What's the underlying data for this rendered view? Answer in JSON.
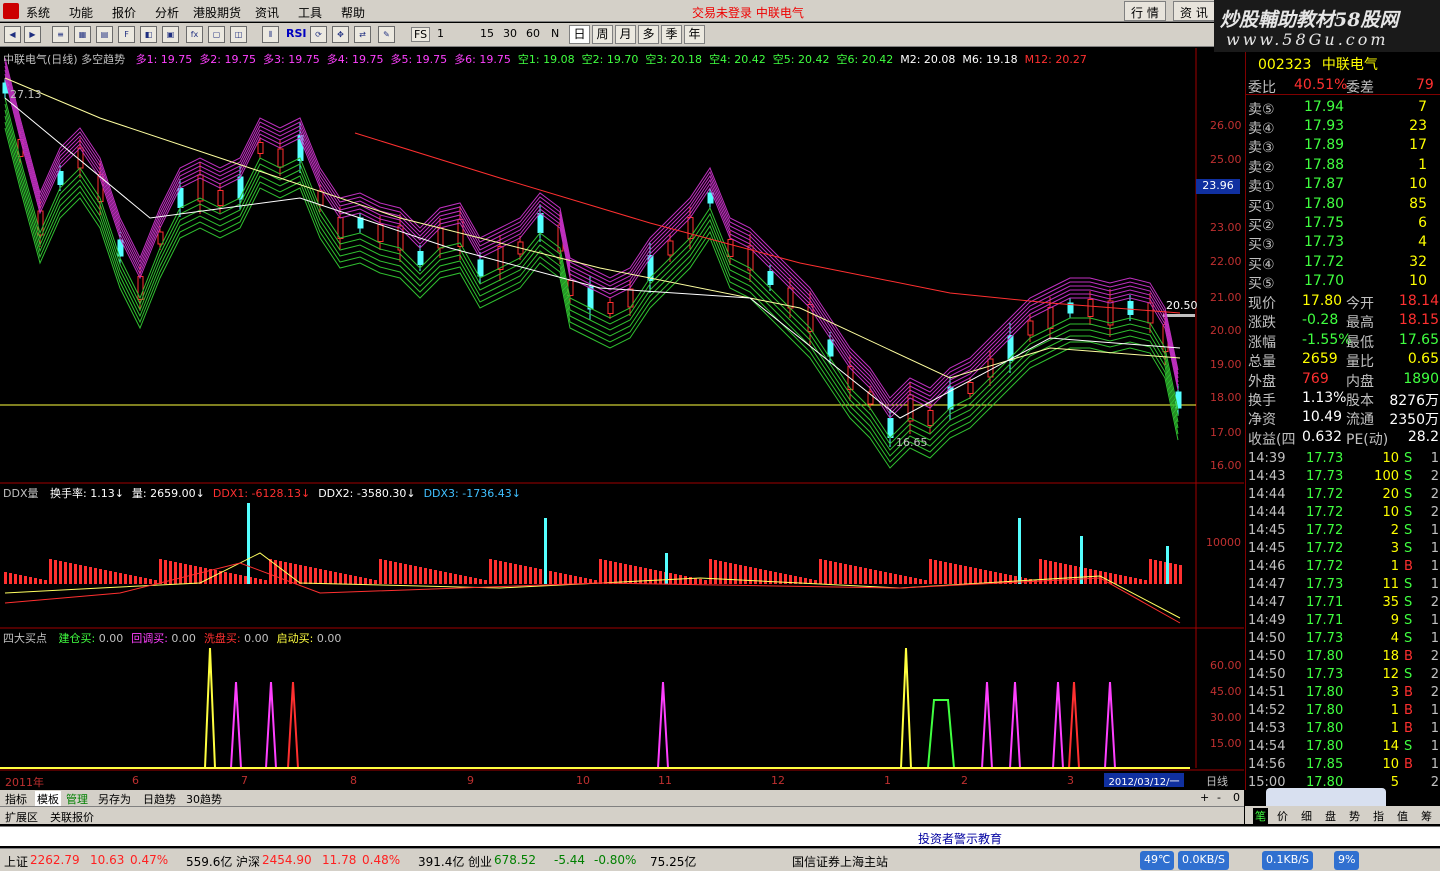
{
  "menu": {
    "items": [
      "系统",
      "功能",
      "报价",
      "分析",
      "港股期货",
      "资讯",
      "工具",
      "帮助"
    ],
    "warning": "交易未登录  中联电气",
    "right_buttons": [
      "行 情",
      "资 讯"
    ]
  },
  "banner": {
    "line1": "炒股輔助教材58股网",
    "line2": "www.58Gu.com"
  },
  "toolbar": {
    "text_buttons": [
      "RSI",
      "FS"
    ],
    "periods": [
      "1",
      "15",
      "30",
      "60",
      "N"
    ],
    "period_buttons": [
      "日",
      "周",
      "月",
      "多",
      "季",
      "年"
    ]
  },
  "main_chart": {
    "title": "中联电气(日线) 多空趋势",
    "legend": [
      {
        "name": "多1:",
        "value": "19.75",
        "color": "#ff40ff"
      },
      {
        "name": "多2:",
        "value": "19.75",
        "color": "#ff40ff"
      },
      {
        "name": "多3:",
        "value": "19.75",
        "color": "#ff40ff"
      },
      {
        "name": "多4:",
        "value": "19.75",
        "color": "#ff40ff"
      },
      {
        "name": "多5:",
        "value": "19.75",
        "color": "#ff40ff"
      },
      {
        "name": "多6:",
        "value": "19.75",
        "color": "#ff40ff"
      },
      {
        "name": "空1:",
        "value": "19.08",
        "color": "#40ff40"
      },
      {
        "name": "空2:",
        "value": "19.70",
        "color": "#40ff40"
      },
      {
        "name": "空3:",
        "value": "20.18",
        "color": "#40ff40"
      },
      {
        "name": "空4:",
        "value": "20.42",
        "color": "#40ff40"
      },
      {
        "name": "空5:",
        "value": "20.42",
        "color": "#40ff40"
      },
      {
        "name": "空6:",
        "value": "20.42",
        "color": "#40ff40"
      },
      {
        "name": "M2:",
        "value": "20.08",
        "color": "#ffffff"
      },
      {
        "name": "M6:",
        "value": "19.18",
        "color": "#ffffff"
      },
      {
        "name": "M12:",
        "value": "20.27",
        "color": "#ff3030"
      }
    ],
    "price_axis": [
      "26.00",
      "25.00",
      "24.00",
      "23.00",
      "22.00",
      "21.00",
      "20.00",
      "19.00",
      "18.00",
      "17.00",
      "16.00"
    ],
    "cursor_price": "23.96",
    "hi_label": "27.13",
    "lo_label": "16.65",
    "current_label": "20.50"
  },
  "volume_panel": {
    "title": "DDX量",
    "items": [
      {
        "label": "换手率:",
        "value": "1.13",
        "color": "#ffffff"
      },
      {
        "label": "量:",
        "value": "2659.00",
        "color": "#ffffff"
      },
      {
        "label": "DDX1:",
        "value": "-6128.13",
        "color": "#ff3030"
      },
      {
        "label": "DDX2:",
        "value": "-3580.30",
        "color": "#ffffff"
      },
      {
        "label": "DDX3:",
        "value": "-1736.43",
        "color": "#40c0ff"
      }
    ],
    "axis": [
      "10000"
    ]
  },
  "signal_panel": {
    "title": "四大买点",
    "items": [
      {
        "label": "建仓买:",
        "value": "0.00",
        "color": "#40ff40"
      },
      {
        "label": "回调买:",
        "value": "0.00",
        "color": "#ff40ff"
      },
      {
        "label": "洗盘买:",
        "value": "0.00",
        "color": "#ff3030"
      },
      {
        "label": "启动买:",
        "value": "0.00",
        "color": "#ffff40"
      }
    ],
    "axis": [
      "60.00",
      "45.00",
      "30.00",
      "15.00"
    ]
  },
  "time_axis": {
    "labels": [
      "2011年",
      "6",
      "7",
      "8",
      "9",
      "10",
      "11",
      "12",
      "1",
      "2",
      "3"
    ],
    "cursor_date": "2012/03/12/一",
    "period": "日线"
  },
  "bottom_tabs": [
    "指标",
    "模板",
    "管理",
    "另存为",
    "日趋势",
    "30趋势"
  ],
  "bottom_tabs2": [
    "扩展区",
    "关联报价"
  ],
  "quote": {
    "code": "002323",
    "name": "中联电气",
    "wei": {
      "label1": "委比",
      "value1": "40.51%",
      "label2": "委差",
      "value2": "79"
    },
    "asks": [
      {
        "label": "卖⑤",
        "price": "17.94",
        "vol": "7"
      },
      {
        "label": "卖④",
        "price": "17.93",
        "vol": "23"
      },
      {
        "label": "卖③",
        "price": "17.89",
        "vol": "17"
      },
      {
        "label": "卖②",
        "price": "17.88",
        "vol": "1"
      },
      {
        "label": "卖①",
        "price": "17.87",
        "vol": "10"
      }
    ],
    "bids": [
      {
        "label": "买①",
        "price": "17.80",
        "vol": "85"
      },
      {
        "label": "买②",
        "price": "17.75",
        "vol": "6"
      },
      {
        "label": "买③",
        "price": "17.73",
        "vol": "4"
      },
      {
        "label": "买④",
        "price": "17.72",
        "vol": "32"
      },
      {
        "label": "买⑤",
        "price": "17.70",
        "vol": "10"
      }
    ],
    "stats": [
      {
        "l1": "现价",
        "v1": "17.80",
        "c1": "#ffff00",
        "l2": "今开",
        "v2": "18.14",
        "c2": "#ff3030"
      },
      {
        "l1": "涨跌",
        "v1": "-0.28",
        "c1": "#40ff40",
        "l2": "最高",
        "v2": "18.15",
        "c2": "#ff3030"
      },
      {
        "l1": "涨幅",
        "v1": "-1.55%",
        "c1": "#40ff40",
        "l2": "最低",
        "v2": "17.65",
        "c2": "#40ff40"
      },
      {
        "l1": "总量",
        "v1": "2659",
        "c1": "#ffff00",
        "l2": "量比",
        "v2": "0.65",
        "c2": "#ffff00"
      },
      {
        "l1": "外盘",
        "v1": "769",
        "c1": "#ff3030",
        "l2": "内盘",
        "v2": "1890",
        "c2": "#40ff40"
      },
      {
        "l1": "换手",
        "v1": "1.13%",
        "c1": "#ffffff",
        "l2": "股本",
        "v2": "8276万",
        "c2": "#ffffff"
      },
      {
        "l1": "净资",
        "v1": "10.49",
        "c1": "#ffffff",
        "l2": "流通",
        "v2": "2350万",
        "c2": "#ffffff"
      },
      {
        "l1": "收益(四",
        "v1": "0.632",
        "c1": "#ffffff",
        "l2": "PE(动)",
        "v2": "28.2",
        "c2": "#ffffff"
      }
    ],
    "ticks": [
      {
        "t": "14:39",
        "p": "17.73",
        "v": "10",
        "bs": "S",
        "n": "1"
      },
      {
        "t": "14:43",
        "p": "17.73",
        "v": "100",
        "bs": "S",
        "n": "2"
      },
      {
        "t": "14:44",
        "p": "17.72",
        "v": "20",
        "bs": "S",
        "n": "2"
      },
      {
        "t": "14:44",
        "p": "17.72",
        "v": "10",
        "bs": "S",
        "n": "2"
      },
      {
        "t": "14:45",
        "p": "17.72",
        "v": "2",
        "bs": "S",
        "n": "1"
      },
      {
        "t": "14:45",
        "p": "17.72",
        "v": "3",
        "bs": "S",
        "n": "1"
      },
      {
        "t": "14:46",
        "p": "17.72",
        "v": "1",
        "bs": "B",
        "n": "1"
      },
      {
        "t": "14:47",
        "p": "17.73",
        "v": "11",
        "bs": "S",
        "n": "1"
      },
      {
        "t": "14:47",
        "p": "17.71",
        "v": "35",
        "bs": "S",
        "n": "2"
      },
      {
        "t": "14:49",
        "p": "17.71",
        "v": "9",
        "bs": "S",
        "n": "1"
      },
      {
        "t": "14:50",
        "p": "17.73",
        "v": "4",
        "bs": "S",
        "n": "1"
      },
      {
        "t": "14:50",
        "p": "17.80",
        "v": "18",
        "bs": "B",
        "n": "2"
      },
      {
        "t": "14:50",
        "p": "17.73",
        "v": "12",
        "bs": "S",
        "n": "2"
      },
      {
        "t": "14:51",
        "p": "17.80",
        "v": "3",
        "bs": "B",
        "n": "2"
      },
      {
        "t": "14:52",
        "p": "17.80",
        "v": "1",
        "bs": "B",
        "n": "1"
      },
      {
        "t": "14:53",
        "p": "17.80",
        "v": "1",
        "bs": "B",
        "n": "1"
      },
      {
        "t": "14:54",
        "p": "17.80",
        "v": "14",
        "bs": "S",
        "n": "1"
      },
      {
        "t": "14:56",
        "p": "17.85",
        "v": "10",
        "bs": "B",
        "n": "1"
      },
      {
        "t": "15:00",
        "p": "17.80",
        "v": "5",
        "bs": "",
        "n": "2"
      }
    ],
    "tabs": [
      "笔",
      "价",
      "细",
      "盘",
      "势",
      "指",
      "值",
      "筹"
    ]
  },
  "notice": "投资者警示教育",
  "status": {
    "indices": [
      {
        "name": "上证",
        "value": "2262.79",
        "change": "10.63",
        "pct": "0.47%",
        "amount": "559.6亿",
        "color": "#ff2020"
      },
      {
        "name": "沪深",
        "value": "2454.90",
        "change": "11.78",
        "pct": "0.48%",
        "amount": "391.4亿",
        "color": "#ff2020"
      },
      {
        "name": "创业",
        "value": "678.52",
        "change": "-5.44",
        "pct": "-0.80%",
        "amount": "75.25亿",
        "color": "#008000"
      }
    ],
    "site": "国信证券上海主站",
    "temp": "49℃",
    "net1": "0.0KB/S",
    "net2": "0.1KB/S",
    "cpu": "9%"
  }
}
